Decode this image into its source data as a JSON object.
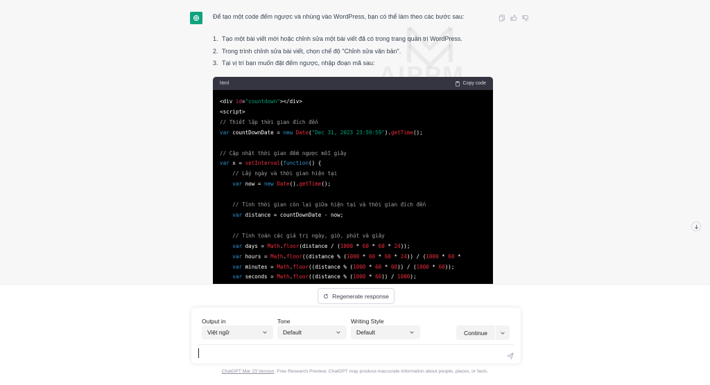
{
  "message": {
    "intro": "Để tạo một code đếm ngược và nhúng vào WordPress, bạn có thể làm theo các bước sau:",
    "steps": [
      {
        "num": "1.",
        "text": "Tạo một bài viết mới hoặc chỉnh sửa một bài viết đã có trong trang quản trị WordPress."
      },
      {
        "num": "2.",
        "text": "Trong trình chỉnh sửa bài viết, chọn chế độ \"Chỉnh sửa văn bản\"."
      },
      {
        "num": "3.",
        "text": "Tại vị trí bạn muốn đặt đếm ngược, nhập đoạn mã sau:"
      }
    ]
  },
  "watermark": "AIPPM",
  "code_block": {
    "language": "html",
    "copy_label": "Copy code"
  },
  "regenerate_label": "Regenerate response",
  "settings": {
    "output_label": "Output in",
    "output_value": "Việt ngữ",
    "tone_label": "Tone",
    "tone_value": "Default",
    "style_label": "Writing Style",
    "style_value": "Default",
    "continue_label": "Continue"
  },
  "footer": {
    "link": "ChatGPT Mar 23 Version",
    "text": ". Free Research Preview. ChatGPT may produce inaccurate information about people, places, or facts."
  },
  "colors": {
    "accent": "#10a37f",
    "code_bg": "#000000",
    "code_header": "#343541"
  }
}
